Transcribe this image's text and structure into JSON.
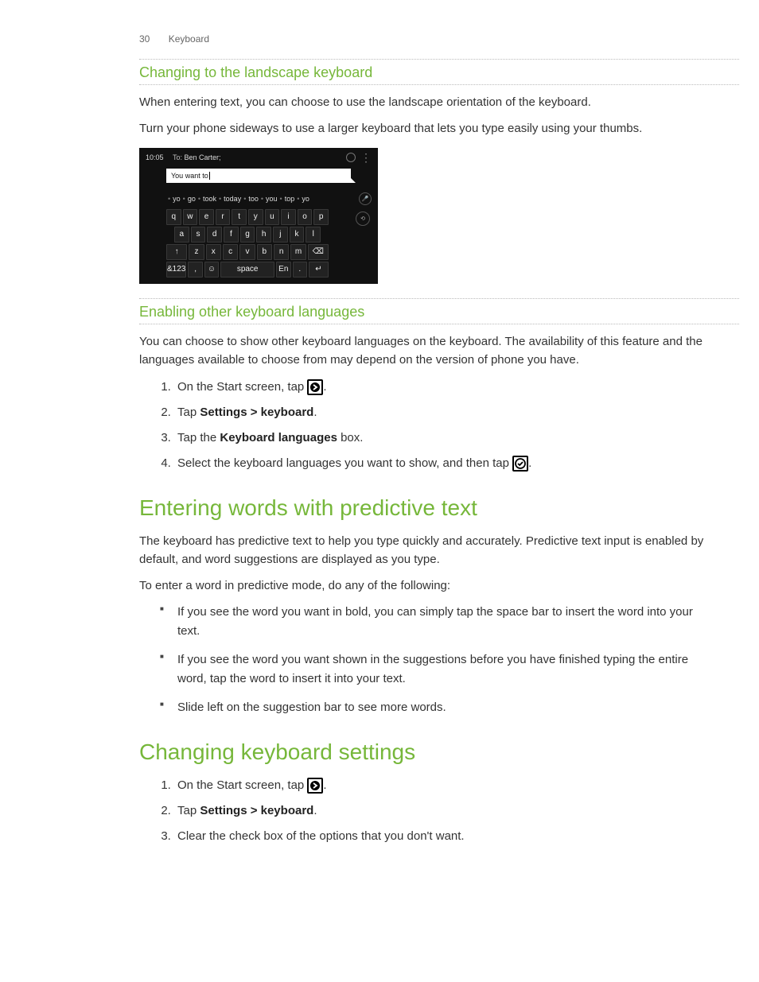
{
  "header": {
    "page_number": "30",
    "section": "Keyboard"
  },
  "sec1": {
    "title": "Changing to the landscape keyboard",
    "p1": "When entering text, you can choose to use the landscape orientation of the keyboard.",
    "p2": "Turn your phone sideways to use a larger keyboard that lets you type easily using your thumbs."
  },
  "phone": {
    "time": "10:05",
    "to_label": "To:",
    "to_value": "Ben Carter;",
    "message": "You want to",
    "suggestions": [
      "yo",
      "go",
      "took",
      "today",
      "too",
      "you",
      "top",
      "yo"
    ],
    "row1": [
      "q",
      "w",
      "e",
      "r",
      "t",
      "y",
      "u",
      "i",
      "o",
      "p"
    ],
    "row2": [
      "a",
      "s",
      "d",
      "f",
      "g",
      "h",
      "j",
      "k",
      "l"
    ],
    "row3_shift": "↑",
    "row3": [
      "z",
      "x",
      "c",
      "v",
      "b",
      "n",
      "m"
    ],
    "row3_back": "⌫",
    "row4_sym": "&123",
    "row4_comma": ",",
    "row4_emoji": "☺",
    "row4_space": "space",
    "row4_lang": "En",
    "row4_period": ".",
    "row4_enter": "↵"
  },
  "sec2": {
    "title": "Enabling other keyboard languages",
    "p1": "You can choose to show other keyboard languages on the keyboard. The availability of this feature and the languages available to choose from may depend on the version of phone you have.",
    "li1a": "On the Start screen, tap ",
    "li1b": ".",
    "li2a": "Tap ",
    "li2b": "Settings > keyboard",
    "li2c": ".",
    "li3a": "Tap the ",
    "li3b": "Keyboard languages",
    "li3c": " box.",
    "li4a": "Select the keyboard languages you want to show, and then tap ",
    "li4b": "."
  },
  "sec3": {
    "title": "Entering words with predictive text",
    "p1": "The keyboard has predictive text to help you type quickly and accurately. Predictive text input is enabled by default, and word suggestions are displayed as you type.",
    "p2": "To enter a word in predictive mode, do any of the following:",
    "b1": "If you see the word you want in bold, you can simply tap the space bar to insert the word into your text.",
    "b2": "If you see the word you want shown in the suggestions before you have finished typing the entire word, tap the word to insert it into your text.",
    "b3": "Slide left on the suggestion bar to see more words."
  },
  "sec4": {
    "title": "Changing keyboard settings",
    "li1a": "On the Start screen, tap ",
    "li1b": ".",
    "li2a": "Tap ",
    "li2b": "Settings > keyboard",
    "li2c": ".",
    "li3": "Clear the check box of the options that you don't want."
  }
}
